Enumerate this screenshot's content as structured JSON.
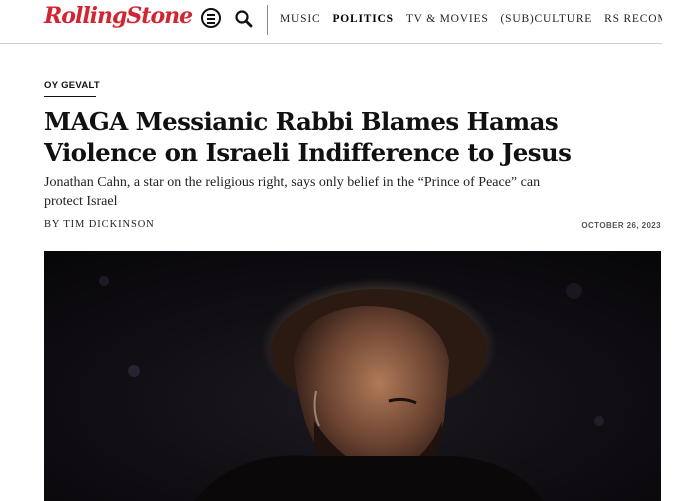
{
  "header": {
    "logo": "RollingStone",
    "nav": [
      "MUSIC",
      "POLITICS",
      "TV & MOVIES",
      "(SUB)CULTURE",
      "RS RECOMM"
    ],
    "active_nav": "POLITICS",
    "brand_color": "#d32531"
  },
  "article": {
    "kicker": "OY GEVALT",
    "headline": "MAGA Messianic Rabbi Blames Hamas Violence on Israeli Indifference to Jesus",
    "dek": "Jonathan Cahn, a star on the religious right, says only belief in the “Prince of Peace” can protect Israel",
    "byline": "BY TIM DICKINSON",
    "date": "OCTOBER 26, 2023"
  },
  "icons": {
    "menu": "menu-icon",
    "search": "search-icon"
  }
}
